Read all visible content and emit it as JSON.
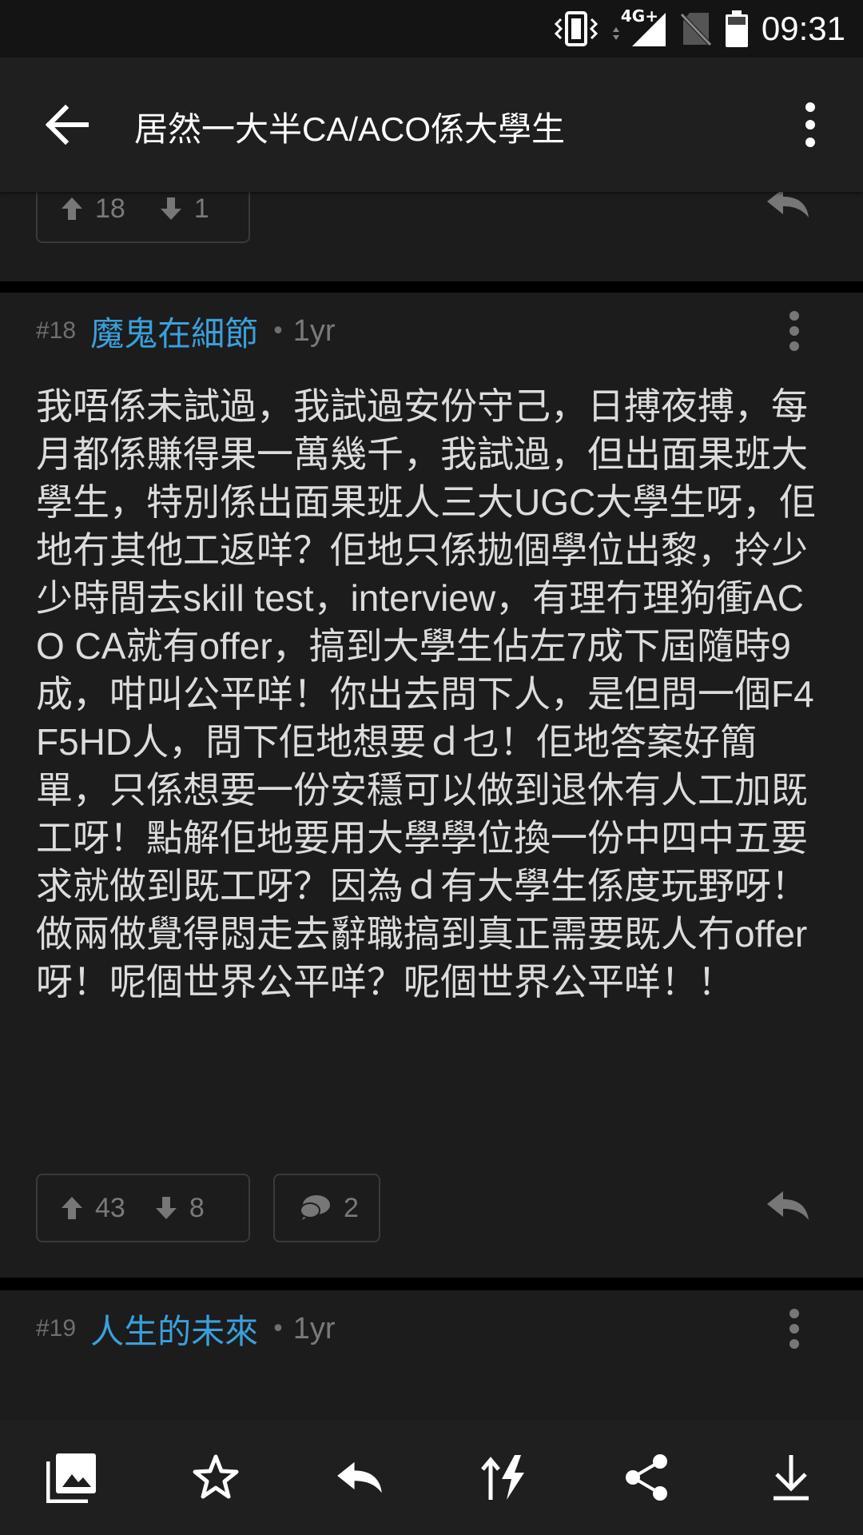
{
  "status_bar": {
    "time": "09:31",
    "network": "4G+",
    "icons": [
      "vibrate-icon",
      "signal-icon",
      "no-sim-icon",
      "battery-icon"
    ]
  },
  "app_bar": {
    "title": "居然一大半CA/ACO係大學生",
    "icons": [
      "back-arrow-icon",
      "more-vert-icon"
    ]
  },
  "posts": [
    {
      "upvotes": "18",
      "downvotes": "1"
    },
    {
      "number": "#18",
      "username": "魔鬼在細節",
      "separator": "•",
      "time": "1yr",
      "body": "我唔係未試過，我試過安份守己，日搏夜搏，每月都係賺得果一萬幾千，我試過，但出面果班大學生，特別係出面果班人三大UGC大學生呀，佢地冇其他工返咩？佢地只係拋個學位出黎，拎少少時間去skill test，interview，有理冇理狗衝ACO CA就有offer，搞到大學生佔左7成下屆隨時9成，咁叫公平咩！你出去問下人，是但問一個F4F5HD人，問下佢地想要ｄ乜！佢地答案好簡單，只係想要一份安穩可以做到退休有人工加既工呀！點解佢地要用大學學位換一份中四中五要求就做到既工呀？因為ｄ有大學生係度玩野呀！做兩做覺得悶走去辭職搞到真正需要既人冇offer 呀！呢個世界公平咩？呢個世界公平咩！！",
      "upvotes": "43",
      "downvotes": "8",
      "comments": "2"
    },
    {
      "number": "#19",
      "username": "人生的未來",
      "separator": "•",
      "time": "1yr"
    }
  ],
  "bottom_bar": {
    "icons": [
      "gallery-icon",
      "star-icon",
      "reply-icon",
      "jump-icon",
      "share-icon",
      "download-icon"
    ]
  }
}
